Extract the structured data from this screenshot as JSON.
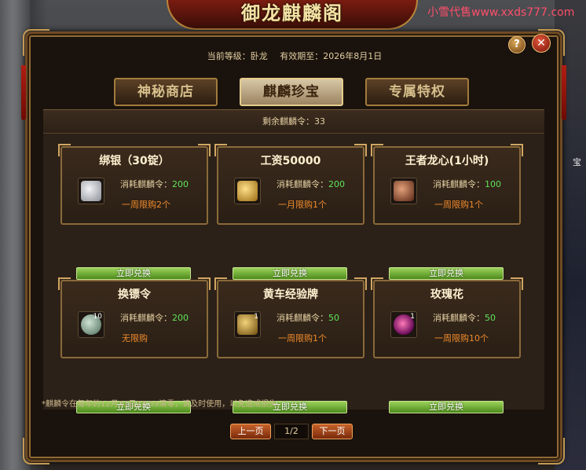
{
  "title": "御龙麒麟阁",
  "watermark": "小雪代售www.xxds777.com",
  "scene_side_char": "宝",
  "info": {
    "level_label": "当前等级：卧龙",
    "expiry_label": "有效期至：2026年8月1日"
  },
  "buttons": {
    "help": "?",
    "close": "✕"
  },
  "tabs": [
    {
      "label": "神秘商店",
      "active": false
    },
    {
      "label": "麒麟珍宝",
      "active": true
    },
    {
      "label": "专属特权",
      "active": false
    }
  ],
  "remaining_tokens": "剩余麒麟令：33",
  "items": [
    {
      "name": "绑银（30锭）",
      "cost_label": "消耗麒麟令：",
      "cost": "200",
      "limit": "一周限购2个",
      "count": "",
      "icon": "silver-ingot-icon",
      "icon_color": "#c8ccd0",
      "button": "立即兑换"
    },
    {
      "name": "工资50000",
      "cost_label": "消耗麒麟令：",
      "cost": "200",
      "limit": "一月限购1个",
      "count": "",
      "icon": "gold-scroll-icon",
      "icon_color": "#d8a53a",
      "button": "立即兑换"
    },
    {
      "name": "王者龙心(1小时)",
      "cost_label": "消耗麒麟令：",
      "cost": "100",
      "limit": "一周限购1个",
      "count": "",
      "icon": "dragon-heart-icon",
      "icon_color": "#a2553a",
      "button": "立即兑换"
    },
    {
      "name": "换镖令",
      "cost_label": "消耗麒麟令：",
      "cost": "200",
      "limit": "无限购",
      "count": "10",
      "icon": "escort-token-icon",
      "icon_color": "#7aa28a",
      "button": "立即兑换"
    },
    {
      "name": "黄车经验牌",
      "cost_label": "消耗麒麟令：",
      "cost": "50",
      "limit": "一周限购1个",
      "count": "1",
      "icon": "yellow-cart-icon",
      "icon_color": "#c89a2a",
      "button": "立即兑换"
    },
    {
      "name": "玫瑰花",
      "cost_label": "消耗麒麟令：",
      "cost": "50",
      "limit": "一周限购10个",
      "count": "1",
      "icon": "rose-icon",
      "icon_color": "#c2207a",
      "button": "立即兑换"
    }
  ],
  "note": "*麒麟令在每年的12月31日23:59清零，请及时使用，以免造成损失。",
  "pager": {
    "prev": "上一页",
    "page": "1/2",
    "next": "下一页"
  }
}
